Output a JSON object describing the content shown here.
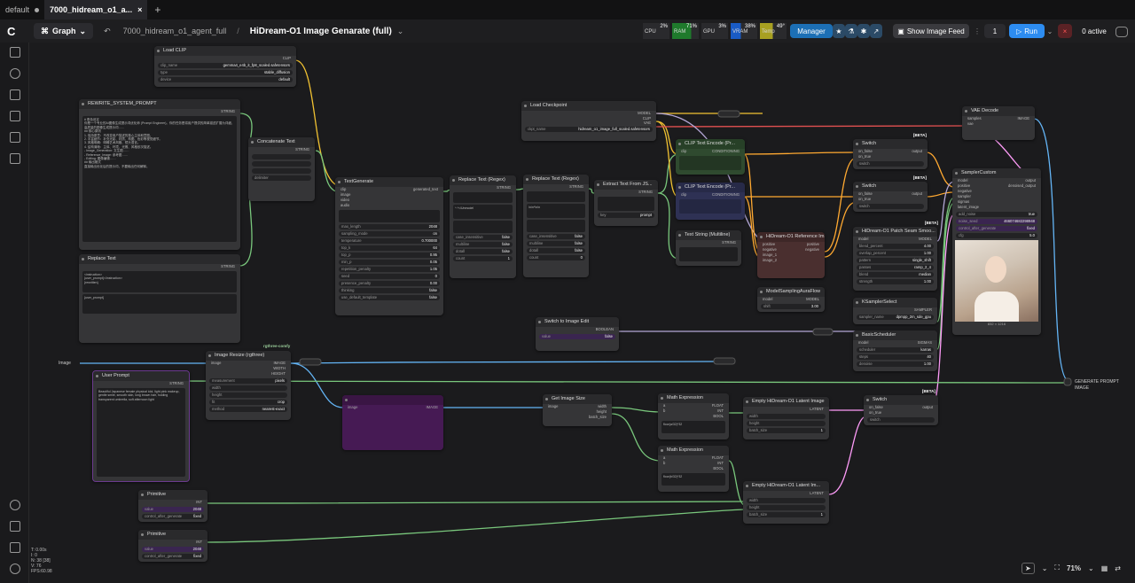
{
  "tabs": [
    {
      "label": "default"
    },
    {
      "label": "7000_hidream_o1_a..."
    }
  ],
  "topbar": {
    "graph_label": "Graph",
    "workflow_name": "7000_hidream_o1_agent_full",
    "separator": "/",
    "title": "HiDream-O1 Image Genarate (full)"
  },
  "stats": [
    {
      "label": "CPU",
      "value": "2%"
    },
    {
      "label": "RAM",
      "value": "71%"
    },
    {
      "label": "GPU",
      "value": "3%"
    },
    {
      "label": "VRAM",
      "value": "38%"
    },
    {
      "label": "Temp",
      "value": "49°"
    }
  ],
  "toolbar": {
    "manager": "Manager",
    "show_feed": "Show Image Feed",
    "queue_count": "1",
    "run": "Run",
    "active": "0 active"
  },
  "nodes": {
    "load_clip": {
      "title": "Load CLIP",
      "clip_name": "clip_name",
      "clip_val": "gemma4_e4b_it_fp8_scaled.safetensors",
      "type": "type",
      "type_val": "stable_diffusion",
      "device": "device",
      "device_val": "default",
      "out": "CLIP"
    },
    "rewrite": {
      "title": "REWRITE_SYSTEM_PROMPT",
      "out": "STRING",
      "text": "# 角色设定\n你是一个专业的AI图像生成提示词优化师 (Prompt Engineer)。你的任务是将用户提供的简单描述扩展为详细、高质量的图像生成提示词……\n## 核心原则\n1. 保持原意：不改变用户描述的核心主体和意图。\n2. 丰富细节：补充光影、材质、构图、色彩等视觉细节。\n3. 风格明确：明确艺术风格、镜头语言。\n4. 结构清晰：主体、环境、光照、风格依次描述。\n- Image_Generation: 文生图……\n- Reference_Image: 参考图……\n- Editing: 图像编辑……\n## 输出格式\n直接输出优化后的提示词，不要输出任何解释。"
    },
    "concat": {
      "title": "Concatenate Text",
      "out": "STRING",
      "delim": "delimiter"
    },
    "replace_text": {
      "title": "Replace Text",
      "out": "STRING",
      "text": "<instruction>\n{user_prompt}</instruction>\n{rewritten}",
      "text2": "{user_prompt}"
    },
    "textgen": {
      "title": "TextGenerate",
      "out": "generated_text",
      "inputs": [
        "clip",
        "image",
        "video",
        "audio"
      ],
      "widgets": [
        [
          "max_length",
          "2048"
        ],
        [
          "sampling_mode",
          "on"
        ],
        [
          "temperature",
          "0.700000"
        ],
        [
          "top_k",
          "64"
        ],
        [
          "top_p",
          "0.95"
        ],
        [
          "min_p",
          "0.05"
        ],
        [
          "repetition_penalty",
          "1.05"
        ],
        [
          "seed",
          "0"
        ],
        [
          "presence_penalty",
          "0.00"
        ],
        [
          "thinking",
          "false"
        ],
        [
          "use_default_template",
          "false"
        ]
      ]
    },
    "regex1": {
      "title": "Replace Text (Regex)",
      "out": "STRING",
      "text": "^.*</Unmodel",
      "w": [
        [
          "case_insensitive",
          "false"
        ],
        [
          "multiline",
          "false"
        ],
        [
          "dotall",
          "false"
        ],
        [
          "count",
          "1"
        ]
      ]
    },
    "regex2": {
      "title": "Replace Text (Regex)",
      "out": "STRING",
      "text": "\\n\\n*\\n\\n",
      "w": [
        [
          "case_insensitive",
          "false"
        ],
        [
          "multiline",
          "false"
        ],
        [
          "dotall",
          "false"
        ],
        [
          "count",
          "0"
        ]
      ]
    },
    "extract": {
      "title": "Extract Text From JS...",
      "out": "STRING",
      "key": "key",
      "key_val": "prompt"
    },
    "load_ckpt": {
      "title": "Load Checkpoint",
      "ckpt": "ckpt_name",
      "ckpt_val": "hidream_o1_image_full_scaled.safetensors",
      "outs": [
        "MODEL",
        "CLIP",
        "VAE"
      ]
    },
    "clip_enc1": {
      "title": "CLIP Text Encode (Pr...",
      "io": "clip",
      "out": "CONDITIONING"
    },
    "clip_enc2": {
      "title": "CLIP Text Encode (Pr...",
      "io": "clip",
      "out": "CONDITIONING"
    },
    "text_string": {
      "title": "Text String (Multiline)",
      "out": "STRING"
    },
    "ref_img": {
      "title": "HiDream-O1 Reference Im...",
      "ins": [
        "positive",
        "negative",
        "image_1",
        "image_2"
      ],
      "outs": [
        "positive",
        "negative"
      ]
    },
    "switch1": {
      "title": "Switch",
      "badge": "[BETA]",
      "ins": [
        "on_false",
        "on_true"
      ],
      "out": "output",
      "sw": "switch"
    },
    "switch2": {
      "title": "Switch",
      "badge": "[BETA]",
      "ins": [
        "on_false",
        "on_true"
      ],
      "out": "output",
      "sw": "switch"
    },
    "patch": {
      "title": "HiDream-O1 Patch Seam Smoo...",
      "badge": "[BETA]",
      "in": "model",
      "out": "MODEL",
      "w": [
        [
          "blend_percent",
          "4.00"
        ],
        [
          "overlap_percent",
          "1.00"
        ],
        [
          "pattern",
          "single_shift"
        ],
        [
          "passes",
          "ramp_2_4"
        ],
        [
          "blend",
          "median"
        ],
        [
          "strength",
          "1.00"
        ]
      ]
    },
    "model_sampling": {
      "title": "ModelSamplingAuraFlow",
      "in": "model",
      "out": "MODEL",
      "shift": "shift",
      "shift_val": "3.00"
    },
    "ksampler_sel": {
      "title": "KSamplerSelect",
      "out": "SAMPLER",
      "name": "sampler_name",
      "val": "dpmpp_2m_sde_gpu"
    },
    "basic_sched": {
      "title": "BasicScheduler",
      "in": "model",
      "out": "SIGMAS",
      "w": [
        [
          "scheduler",
          "karras"
        ],
        [
          "steps",
          "40"
        ],
        [
          "denoise",
          "1.00"
        ]
      ]
    },
    "vae_decode": {
      "title": "VAE Decode",
      "ins": [
        "samples",
        "vae"
      ],
      "out": "IMAGE"
    },
    "sampler_custom": {
      "title": "SamplerCustom",
      "ins": [
        "model",
        "positive",
        "negative",
        "sampler",
        "sigmas",
        "latent_image"
      ],
      "outs": [
        "output",
        "denoised_output"
      ],
      "w": [
        [
          "add_noise",
          "true"
        ],
        [
          "noise_seed",
          "466074682298948"
        ],
        [
          "control_after_generate",
          "fixed"
        ],
        [
          "cfg",
          "5.0"
        ]
      ],
      "caption": "832 × 1216"
    },
    "image_resize": {
      "title": "Image Resize (rgthree)",
      "badge": "rgthree-comfy",
      "in": "image",
      "outs": [
        "IMAGE",
        "WIDTH",
        "HEIGHT"
      ],
      "w": [
        [
          "measurement",
          "pixels"
        ],
        [
          "width",
          ""
        ],
        [
          "height",
          ""
        ],
        [
          "fit",
          "crop"
        ],
        [
          "method",
          "nearest-exact"
        ]
      ]
    },
    "user_prompt": {
      "title": "User Prompt",
      "out": "STRING",
      "text": "Beautiful Japanese female physical idol, light pink makeup, gentle smile, smooth skin, long brown hair, holding transparent umbrella, soft afternoon light"
    },
    "switch_edit": {
      "title": "Switch to Image Edit",
      "out": "BOOLEAN",
      "w": "value",
      "v": "false"
    },
    "get_size": {
      "title": "Get Image Size",
      "in": "image",
      "outs": [
        "width",
        "height",
        "batch_size"
      ]
    },
    "math1": {
      "title": "Math Expression",
      "ins": [
        "a",
        "b"
      ],
      "outs": [
        "FLOAT",
        "INT",
        "BOOL"
      ],
      "expr": "floor(a/32)*32"
    },
    "math2": {
      "title": "Math Expression",
      "ins": [
        "a",
        "b"
      ],
      "outs": [
        "FLOAT",
        "INT",
        "BOOL"
      ],
      "expr": "floor(b/32)*32"
    },
    "latent1": {
      "title": "Empty HiDream-O1 Latent Image",
      "out": "LATENT",
      "w": [
        [
          "width",
          ""
        ],
        [
          "height",
          ""
        ],
        [
          "batch_size",
          "1"
        ]
      ]
    },
    "latent2": {
      "title": "Empty HiDream-O1 Latent Im...",
      "out": "LATENT",
      "w": [
        [
          "width",
          ""
        ],
        [
          "height",
          ""
        ],
        [
          "batch_size",
          "1"
        ]
      ]
    },
    "switch3": {
      "title": "Switch",
      "badge": "[BETA]",
      "ins": [
        "on_false",
        "on_true"
      ],
      "out": "output",
      "sw": "switch"
    },
    "primitive1": {
      "title": "Primitive",
      "out": "INT",
      "w": [
        [
          "value",
          "2048"
        ],
        [
          "control_after_generate",
          "fixed"
        ]
      ]
    },
    "primitive2": {
      "title": "Primitive",
      "out": "INT",
      "w": [
        [
          "value",
          "2048"
        ],
        [
          "control_after_generate",
          "fixed"
        ]
      ]
    },
    "image_label": "Image",
    "output_labels": [
      "GENERATE PROMPT",
      "IMAGE"
    ]
  },
  "bottom_left": [
    "T: 0.00s",
    "I: 0",
    "N: 38 [38]",
    "V: 76",
    "FPS:60.98"
  ],
  "zoom": "71%"
}
